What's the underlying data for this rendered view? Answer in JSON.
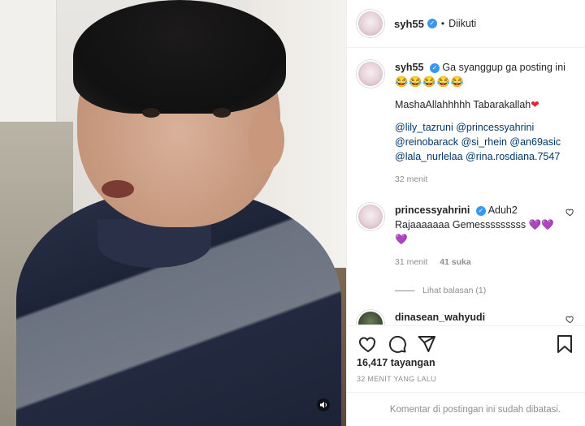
{
  "header": {
    "username": "syh55",
    "verified_glyph": "✓",
    "separator": "•",
    "follow_status": "Diikuti"
  },
  "caption": {
    "username": "syh55",
    "line1": "Ga syanggup ga posting ini",
    "line1_emojis": "😂😂😂😂😂",
    "line2": "MashaAllahhhhh Tabarakallah",
    "line2_heart": "❤",
    "mentions_line1": "@lily_tazruni @princessyahrini",
    "mentions_line2": "@reinobarack @si_rhein @an69asic",
    "mentions_line3": "@lala_nurlelaa @rina.rosdiana.7547",
    "time": "32 menit"
  },
  "comments": [
    {
      "username": "princessyahrini",
      "line1": "Aduh2",
      "line2": "Rajaaaaaaa Gemesssssssss",
      "hearts1": "💜💜",
      "hearts2": "💜",
      "time": "31 menit",
      "likes": "41 suka",
      "view_replies": "Lihat balasan (1)"
    },
    {
      "username": "dinasean_wahyudi"
    }
  ],
  "stats": {
    "views": "16,417 tayangan",
    "time_ago": "32 MENIT YANG LALU"
  },
  "footer": {
    "comments_disabled": "Komentar di postingan ini sudah dibatasi."
  },
  "colors": {
    "verified": "#3897f0",
    "mention": "#00376b",
    "muted": "#8e8e8e"
  },
  "icons": {
    "video_sound": "speaker-icon",
    "like": "heart-icon",
    "comment": "comment-icon",
    "share": "share-icon",
    "save": "bookmark-icon",
    "comment_like": "small-heart-icon"
  }
}
